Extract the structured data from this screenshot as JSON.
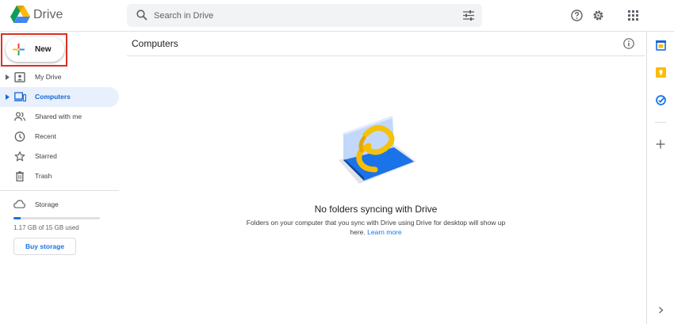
{
  "header": {
    "app_name": "Drive",
    "search_placeholder": "Search in Drive"
  },
  "sidebar": {
    "new_label": "New",
    "items": [
      {
        "label": "My Drive",
        "icon": "my-drive-icon",
        "expandable": true,
        "active": false
      },
      {
        "label": "Computers",
        "icon": "computers-icon",
        "expandable": true,
        "active": true
      },
      {
        "label": "Shared with me",
        "icon": "shared-icon",
        "expandable": false,
        "active": false
      },
      {
        "label": "Recent",
        "icon": "clock-icon",
        "expandable": false,
        "active": false
      },
      {
        "label": "Starred",
        "icon": "star-icon",
        "expandable": false,
        "active": false
      },
      {
        "label": "Trash",
        "icon": "trash-icon",
        "expandable": false,
        "active": false
      }
    ],
    "storage": {
      "label": "Storage",
      "used_text": "1.17 GB of 15 GB used",
      "used_fraction": 0.078,
      "buy_label": "Buy storage"
    }
  },
  "main": {
    "title": "Computers",
    "empty_title": "No folders syncing with Drive",
    "empty_desc": "Folders on your computer that you sync with Drive using Drive for desktop will show up here.",
    "learn_more": "Learn more"
  },
  "colors": {
    "accent": "#1a73e8",
    "active_bg": "#e8f0fe",
    "highlight_box": "#d93025"
  }
}
